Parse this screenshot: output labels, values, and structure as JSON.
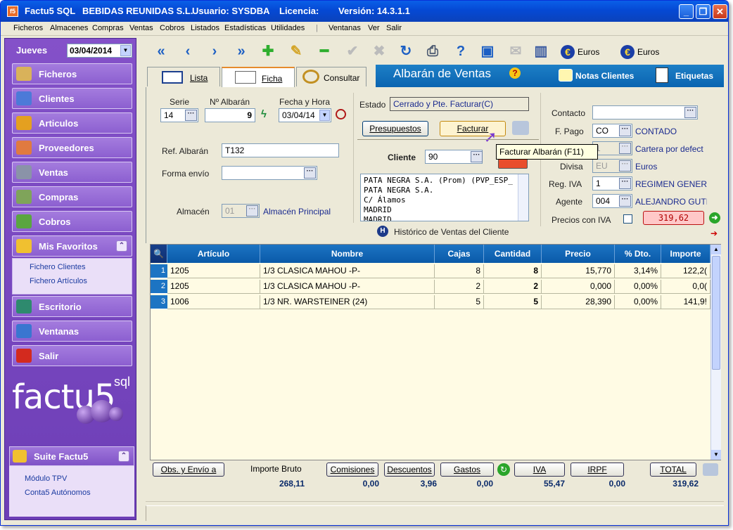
{
  "titlebar": {
    "icon_text": "f5",
    "app": "Factu5 SQL",
    "company": "BEBIDAS REUNIDAS S.L.",
    "user": "Usuario: SYSDBA",
    "license": "Licencia:",
    "version": "Versión: 14.3.1.1"
  },
  "menu": [
    "Ficheros",
    "Almacenes",
    "Compras",
    "Ventas",
    "Cobros",
    "Listados",
    "Estadísticas",
    "Utilidades",
    "Ventanas",
    "Ver",
    "Salir"
  ],
  "sidebar": {
    "day": "Jueves",
    "date": "03/04/2014",
    "items": [
      {
        "label": "Ficheros",
        "icon": "keys-icon"
      },
      {
        "label": "Clientes",
        "icon": "client-card-icon"
      },
      {
        "label": "Articulos",
        "icon": "boxes-icon"
      },
      {
        "label": "Proveedores",
        "icon": "people-icon"
      },
      {
        "label": "Ventas",
        "icon": "cash-register-icon"
      },
      {
        "label": "Compras",
        "icon": "cart-icon"
      },
      {
        "label": "Cobros",
        "icon": "money-icon"
      },
      {
        "label": "Mis Favoritos",
        "icon": "star-icon"
      }
    ],
    "favorites": [
      "Fichero Clientes",
      "Fichero Artículos"
    ],
    "lower": [
      {
        "label": "Escritorio"
      },
      {
        "label": "Ventanas"
      },
      {
        "label": "Salir"
      }
    ],
    "logo": "factu5",
    "logo_suffix": "sql",
    "suite_title": "Suite Factu5",
    "suite_links": [
      "Módulo TPV",
      "Conta5 Autónomos"
    ]
  },
  "toolbar": {
    "euro1": "Euros",
    "euro2": "Euros"
  },
  "tabs": [
    "Lista",
    "Ficha",
    "Consultar"
  ],
  "header": {
    "title": "Albarán de Ventas",
    "notes": "Notas Clientes",
    "labels": "Etiquetas"
  },
  "form": {
    "serie_label": "Serie",
    "serie": "14",
    "albaran_label": "Nº Albarán",
    "albaran": "9",
    "fecha_label": "Fecha y Hora",
    "fecha": "03/04/14",
    "estado_label": "Estado",
    "estado": "Cerrado y Pte. Facturar(C)",
    "presupuestos": "Presupuestos",
    "facturar": "Facturar",
    "tooltip": "Facturar Albarán (F11)",
    "ref_label": "Ref. Albarán",
    "ref": "T132",
    "envio_label": "Forma envío",
    "envio": "",
    "almacen_label": "Almacén",
    "almacen_code": "01",
    "almacen_name": "Almacén Principal",
    "cliente_label": "Cliente",
    "cliente": "90",
    "address": [
      "PATA NEGRA  S.A.  (Prom) (PVP_ESP_",
      "PATA NEGRA  S.A.",
      "C/ Álamos",
      "MADRID",
      "MADRID"
    ],
    "historico": "Histórico de Ventas del Cliente",
    "contacto_label": "Contacto",
    "contacto": "",
    "fpago_label": "F. Pago",
    "fpago": "CO",
    "fpago_name": "CONTADO",
    "cartera_code": "1",
    "cartera_name": "Cartera por defect",
    "divisa_label": "Divisa",
    "divisa": "EU",
    "divisa_name": "Euros",
    "regiva_label": "Reg. IVA",
    "regiva": "1",
    "regiva_name": "REGIMEN GENERAI",
    "agente_label": "Agente",
    "agente": "004",
    "agente_name": "ALEJANDRO GUTII",
    "precios_label": "Precios con IVA",
    "total_badge": "319,62"
  },
  "grid": {
    "headers": [
      "Artículo",
      "Nombre",
      "Cajas",
      "Cantidad",
      "Precio",
      "% Dto.",
      "Importe"
    ],
    "rows": [
      {
        "n": "1",
        "articulo": "1205",
        "nombre": "1/3 CLASICA MAHOU  -P-",
        "cajas": "8",
        "cantidad": "8",
        "precio": "15,770",
        "dto": "3,14%",
        "importe": "122,2("
      },
      {
        "n": "2",
        "articulo": "1205",
        "nombre": "1/3 CLASICA MAHOU  -P-",
        "cajas": "2",
        "cantidad": "2",
        "precio": "0,000",
        "dto": "0,00%",
        "importe": "0,0("
      },
      {
        "n": "3",
        "articulo": "1006",
        "nombre": "1/3 NR. WARSTEINER (24)",
        "cajas": "5",
        "cantidad": "5",
        "precio": "28,390",
        "dto": "0,00%",
        "importe": "141,9!"
      }
    ]
  },
  "footer": {
    "obs": "Obs. y Envío a",
    "bruto_label": "Importe Bruto",
    "comisiones": "Comisiones",
    "descuentos": "Descuentos",
    "gastos": "Gastos",
    "iva": "IVA",
    "irpf": "IRPF",
    "total": "TOTAL",
    "bruto": "268,11",
    "v_comisiones": "0,00",
    "v_descuentos": "3,96",
    "v_gastos": "0,00",
    "v_iva": "55,47",
    "v_irpf": "0,00",
    "v_total": "319,62"
  }
}
